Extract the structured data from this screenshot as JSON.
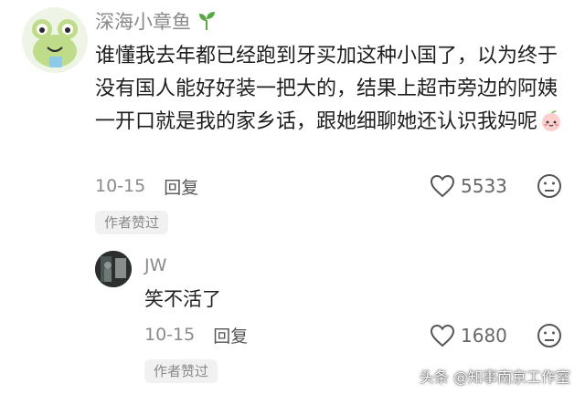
{
  "comment": {
    "username": "深海小章鱼",
    "text": "谁懂我去年都已经跑到牙买加这种小国了，以为终于没有国人能好好装一把大的，结果上超市旁边的阿姨一开口就是我的家乡话，跟她细聊她还认识我妈呢",
    "date": "10-15",
    "reply_label": "回复",
    "likes": "5533",
    "badge": "作者赞过"
  },
  "reply": {
    "username": "JW",
    "text": "笑不活了",
    "date": "10-15",
    "reply_label": "回复",
    "likes": "1680",
    "badge": "作者赞过"
  },
  "watermark": "头条 @知事南京工作室",
  "icons": {
    "username_decoration": "sprout-icon",
    "inline_emoji": "peach-emoji-icon",
    "like": "heart-outline-icon",
    "dislike": "frown-face-icon"
  },
  "colors": {
    "meta_text": "#8a8a8a",
    "body_text": "#1e1e1e",
    "badge_bg": "#f1f1f1",
    "sprout": "#5aa845"
  }
}
